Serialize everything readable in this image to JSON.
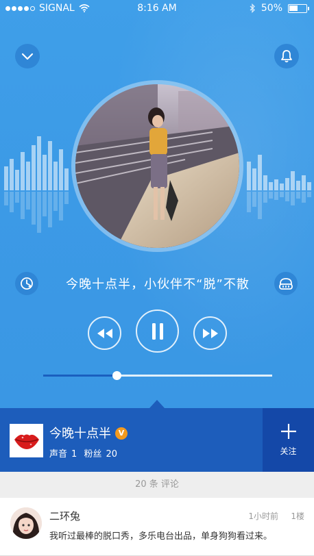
{
  "status_bar": {
    "carrier": "SIGNAL",
    "time": "8:16 AM",
    "battery": "50%",
    "battery_level": 0.5
  },
  "player": {
    "track_title": "今晚十点半，小伙伴不“脱”不散",
    "progress": 0.32,
    "icons": {
      "collapse": "chevron-down-icon",
      "alarm": "bell-icon",
      "timer": "timer-icon",
      "audio": "headphones-icon",
      "rewind": "rewind-icon",
      "pause": "pause-icon",
      "forward": "fast-forward-icon"
    }
  },
  "author": {
    "name": "今晚十点半",
    "verified_badge": "V",
    "sound_label": "声音",
    "sound_count": "1",
    "fans_label": "粉丝",
    "fans_count": "20",
    "follow_label": "关注"
  },
  "comments": {
    "header": "20 条 评论",
    "items": [
      {
        "user": "二环兔",
        "time": "1小时前",
        "floor": "1楼",
        "text": "我听过最棒的脱口秀，多乐电台出品，单身狗狗看过来。"
      }
    ]
  },
  "colors": {
    "hero_blue": "#3c9ae6",
    "author_bar": "#1d5dbb",
    "follow_bar": "#1448a8",
    "progress_done": "#1a5fbf",
    "badge_orange": "#f39a1e"
  }
}
